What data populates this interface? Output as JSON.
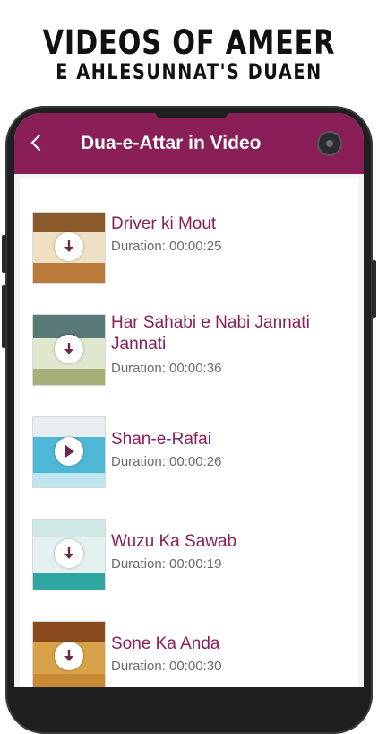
{
  "promo": {
    "line1": "VIDEOS OF AMEER",
    "line2": "E AHLESUNNAT'S DUAEN"
  },
  "appbar": {
    "title": "Dua-e-Attar in Video",
    "color": "#8a1f58"
  },
  "videos": [
    {
      "title": "Driver ki Mout",
      "duration": "Duration: 00:00:25"
    },
    {
      "title": "Har Sahabi e Nabi Jannati Jannati",
      "duration": "Duration: 00:00:36"
    },
    {
      "title": "Shan-e-Rafai",
      "duration": "Duration: 00:00:26"
    },
    {
      "title": "Wuzu Ka Sawab",
      "duration": "Duration: 00:00:19"
    },
    {
      "title": "Sone Ka Anda",
      "duration": "Duration: 00:00:30"
    }
  ],
  "icons": {
    "back": "chevron-left-icon",
    "camera": "camera-icon",
    "download": "download-icon"
  }
}
